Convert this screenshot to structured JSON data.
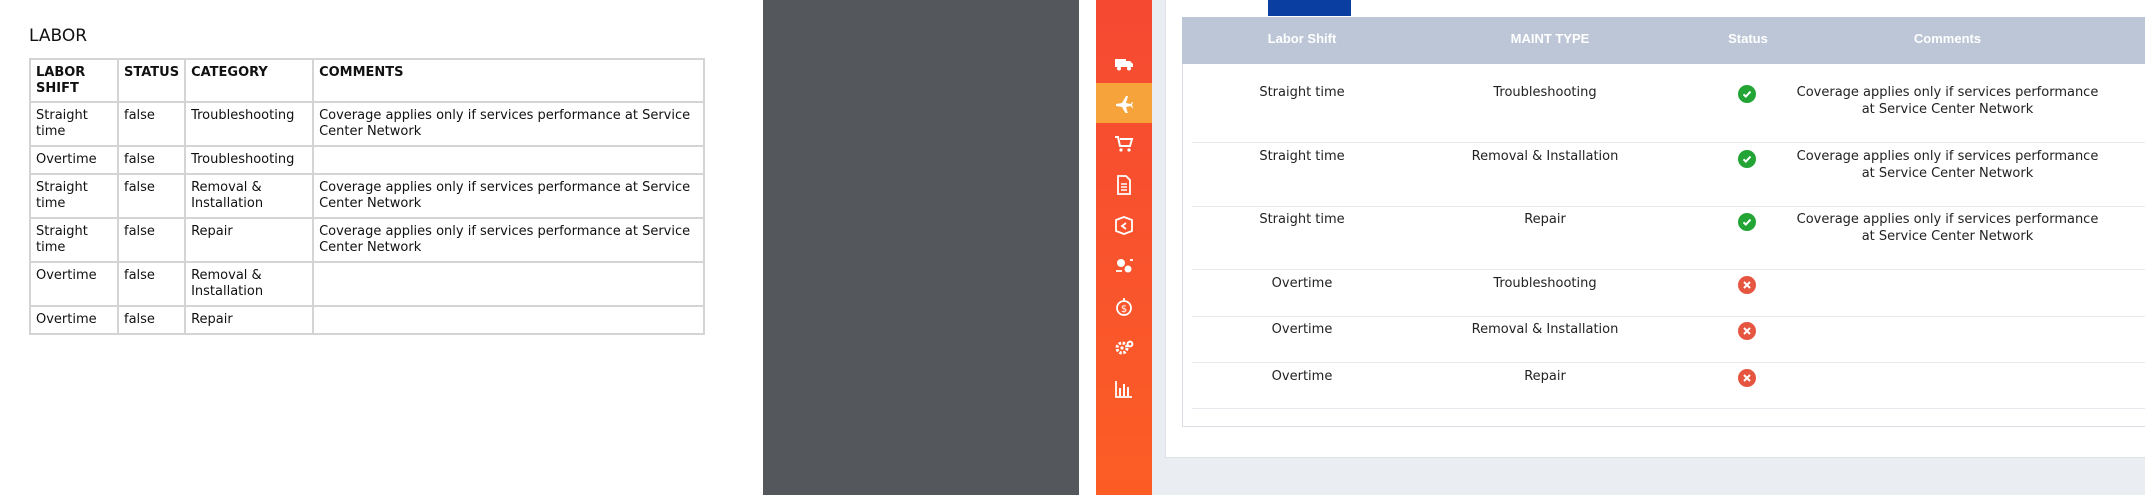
{
  "document": {
    "title": "LABOR",
    "headers": [
      "LABOR SHIFT",
      "STATUS",
      "CATEGORY",
      "COMMENTS"
    ],
    "rows": [
      [
        "Straight time",
        "false",
        "Troubleshooting",
        "Coverage applies only if services performance at Service Center Network"
      ],
      [
        "Overtime",
        "false",
        "Troubleshooting",
        ""
      ],
      [
        "Straight time",
        "false",
        "Removal & Installation",
        "Coverage applies only if services performance at Service Center Network"
      ],
      [
        "Straight time",
        "false",
        "Repair",
        "Coverage applies only if services performance at Service Center Network"
      ],
      [
        "Overtime",
        "false",
        "Removal & Installation",
        ""
      ],
      [
        "Overtime",
        "false",
        "Repair",
        ""
      ]
    ]
  },
  "sidebar": {
    "items": [
      {
        "icon": "truck-icon"
      },
      {
        "icon": "airplane-icon",
        "active": true
      },
      {
        "icon": "cart-icon"
      },
      {
        "icon": "document-icon"
      },
      {
        "icon": "box-return-icon"
      },
      {
        "icon": "gears-exchange-icon"
      },
      {
        "icon": "dollar-cycle-icon"
      },
      {
        "icon": "settings-icon"
      },
      {
        "icon": "bar-chart-icon"
      }
    ]
  },
  "grid": {
    "headers": {
      "shift": "Labor Shift",
      "type": "MAINT TYPE",
      "status": "Status",
      "comments": "Comments"
    },
    "rows": [
      {
        "shift": "Straight time",
        "type": "Troubleshooting",
        "status": "ok",
        "comment_1": "Coverage applies only if services performance",
        "comment_2": "at Service Center Network"
      },
      {
        "shift": "Straight time",
        "type": "Removal & Installation",
        "status": "ok",
        "comment_1": "Coverage applies only if services performance",
        "comment_2": "at Service Center Network"
      },
      {
        "shift": "Straight time",
        "type": "Repair",
        "status": "ok",
        "comment_1": "Coverage applies only if services performance",
        "comment_2": "at Service Center Network"
      },
      {
        "shift": "Overtime",
        "type": "Troubleshooting",
        "status": "no",
        "comment_1": "",
        "comment_2": ""
      },
      {
        "shift": "Overtime",
        "type": "Removal & Installation",
        "status": "no",
        "comment_1": "",
        "comment_2": ""
      },
      {
        "shift": "Overtime",
        "type": "Repair",
        "status": "no",
        "comment_1": "",
        "comment_2": ""
      }
    ]
  },
  "colors": {
    "sidebar": "#f9552c",
    "sidebar_active": "#f7a33b",
    "grid_header": "#bcc6d6",
    "status_ok": "#22a534",
    "status_no": "#e6553f",
    "tab_accent": "#0a3ea0"
  }
}
